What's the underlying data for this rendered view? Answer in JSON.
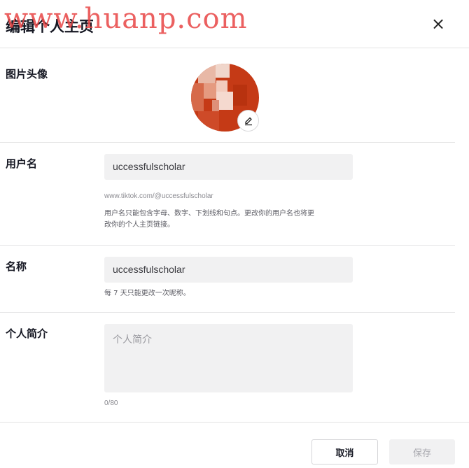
{
  "watermark": "www.huanp.com",
  "header": {
    "title": "编辑个人主页",
    "close_label": "×"
  },
  "photo": {
    "label": "图片头像"
  },
  "username": {
    "label": "用户名",
    "value": "uccessfulscholar",
    "url": "www.tiktok.com/@uccessfulscholar",
    "hint_line1": "用户名只能包含字母、数字、下划线和句点。更改你的用户名也将更",
    "hint_line2": "改你的个人主页链接。"
  },
  "name": {
    "label": "名称",
    "value": "uccessfulscholar",
    "hint": "每 7 天只能更改一次昵称。"
  },
  "bio": {
    "label": "个人简介",
    "placeholder": "个人简介",
    "count": "0/80"
  },
  "footer": {
    "cancel_label": "取消",
    "save_label": "保存"
  },
  "colors": {
    "avatar": "#c53a16",
    "field_bg": "#f1f1f2",
    "watermark": "#e84545"
  },
  "icons": {
    "close": "close-icon",
    "edit": "pencil-icon"
  }
}
